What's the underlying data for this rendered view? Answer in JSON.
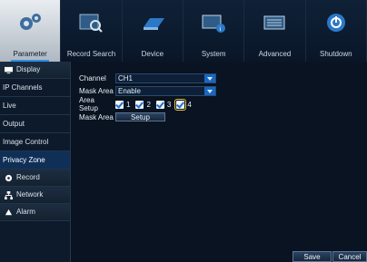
{
  "nav": {
    "tabs": [
      {
        "label": "Parameter",
        "icon": "gear-icon",
        "active": true
      },
      {
        "label": "Record Search",
        "icon": "search-icon",
        "active": false
      },
      {
        "label": "Device",
        "icon": "hard-disk-icon",
        "active": false
      },
      {
        "label": "System",
        "icon": "system-info-icon",
        "active": false
      },
      {
        "label": "Advanced",
        "icon": "advanced-settings-icon",
        "active": false
      },
      {
        "label": "Shutdown",
        "icon": "power-icon",
        "active": false
      }
    ]
  },
  "sidebar": {
    "items": [
      {
        "label": "Display",
        "type": "group",
        "icon": "monitor-icon"
      },
      {
        "label": "IP Channels",
        "type": "sub"
      },
      {
        "label": "Live",
        "type": "sub"
      },
      {
        "label": "Output",
        "type": "sub"
      },
      {
        "label": "Image Control",
        "type": "sub"
      },
      {
        "label": "Privacy Zone",
        "type": "sub",
        "active": true
      },
      {
        "label": "Record",
        "type": "group",
        "icon": "record-icon"
      },
      {
        "label": "Network",
        "type": "group",
        "icon": "network-icon"
      },
      {
        "label": "Alarm",
        "type": "group",
        "icon": "alarm-icon"
      }
    ]
  },
  "form": {
    "channel_label": "Channel",
    "channel_value": "CH1",
    "mask_area_label": "Mask Area",
    "mask_area_value": "Enable",
    "area_setup_label": "Area Setup",
    "areas": [
      {
        "label": "1",
        "checked": true
      },
      {
        "label": "2",
        "checked": true
      },
      {
        "label": "3",
        "checked": true
      },
      {
        "label": "4",
        "checked": true,
        "focused": true
      }
    ],
    "mask_area2_label": "Mask Area",
    "setup_button": "Setup"
  },
  "footer": {
    "save": "Save",
    "cancel": "Cancel"
  },
  "colors": {
    "accent": "#1967c2",
    "active_sidebar": "#0f2f57",
    "focus": "#e2c23b"
  }
}
